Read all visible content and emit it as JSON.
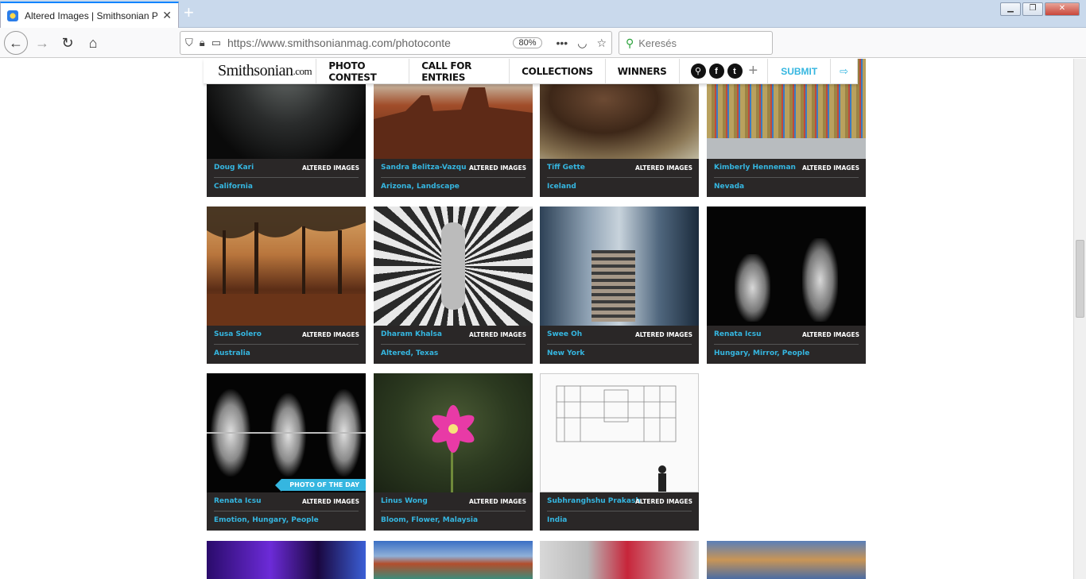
{
  "browser": {
    "tab_title": "Altered Images | Smithsonian P",
    "url": "https://www.smithsonianmag.com/photoconte",
    "zoom": "80%",
    "search_placeholder": "Keresés"
  },
  "site": {
    "logo": "Smithsonian",
    "logo_suffix": ".com",
    "nav": [
      "PHOTO CONTEST",
      "CALL FOR ENTRIES",
      "COLLECTIONS",
      "WINNERS"
    ],
    "submit": "SUBMIT"
  },
  "cards": [
    {
      "name": "Doug Kari",
      "category": "ALTERED IMAGES",
      "tags": "California"
    },
    {
      "name": "Sandra Belitza-Vazqu",
      "category": "ALTERED IMAGES",
      "tags": "Arizona, Landscape"
    },
    {
      "name": "Tiff Gette",
      "category": "ALTERED IMAGES",
      "tags": "Iceland"
    },
    {
      "name": "Kimberly Henneman",
      "category": "ALTERED IMAGES",
      "tags": "Nevada"
    },
    {
      "name": "Susa Solero",
      "category": "ALTERED IMAGES",
      "tags": "Australia"
    },
    {
      "name": "Dharam Khalsa",
      "category": "ALTERED IMAGES",
      "tags": "Altered, Texas"
    },
    {
      "name": "Swee Oh",
      "category": "ALTERED IMAGES",
      "tags": "New York"
    },
    {
      "name": "Renata Icsu",
      "category": "ALTERED IMAGES",
      "tags": "Hungary, Mirror, People"
    },
    {
      "name": "Renata Icsu",
      "category": "ALTERED IMAGES",
      "tags": "Emotion, Hungary, People",
      "badge": "PHOTO OF THE DAY"
    },
    {
      "name": "Linus Wong",
      "category": "ALTERED IMAGES",
      "tags": "Bloom, Flower, Malaysia"
    },
    {
      "name": "Subhranghshu Prakash",
      "category": "ALTERED IMAGES",
      "tags": "India"
    }
  ]
}
